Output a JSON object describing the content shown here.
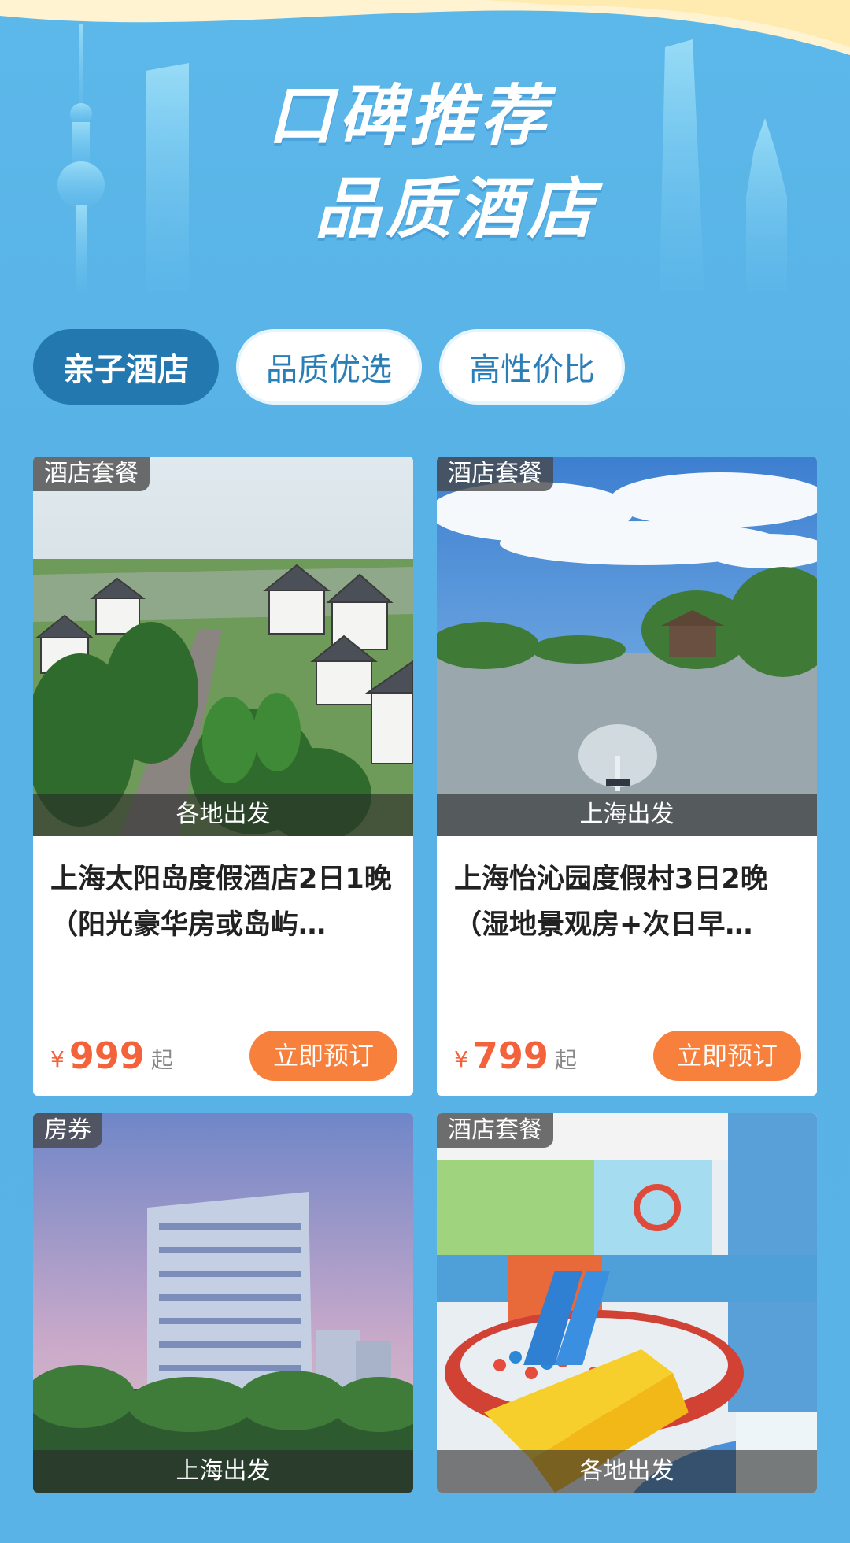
{
  "hero": {
    "line1": "口碑推荐",
    "line2": "品质酒店"
  },
  "tabs": [
    {
      "label": "亲子酒店",
      "active": true
    },
    {
      "label": "品质优选",
      "active": false
    },
    {
      "label": "高性价比",
      "active": false
    }
  ],
  "cards": [
    {
      "tag": "酒店套餐",
      "depart": "各地出发",
      "title": "上海太阳岛度假酒店2日1晚（阳光豪华房或岛屿…",
      "currency": "¥",
      "price": "999",
      "suffix": "起",
      "button": "立即预订"
    },
    {
      "tag": "酒店套餐",
      "depart": "上海出发",
      "title": "上海怡沁园度假村3日2晚（湿地景观房+次日早…",
      "currency": "¥",
      "price": "799",
      "suffix": "起",
      "button": "立即预订"
    },
    {
      "tag": "房券",
      "depart": "上海出发"
    },
    {
      "tag": "酒店套餐",
      "depart": "各地出发"
    }
  ],
  "colors": {
    "background": "#5bb4e8",
    "accent": "#f8803d",
    "price": "#f4623b",
    "tab_active": "#2378b0"
  }
}
